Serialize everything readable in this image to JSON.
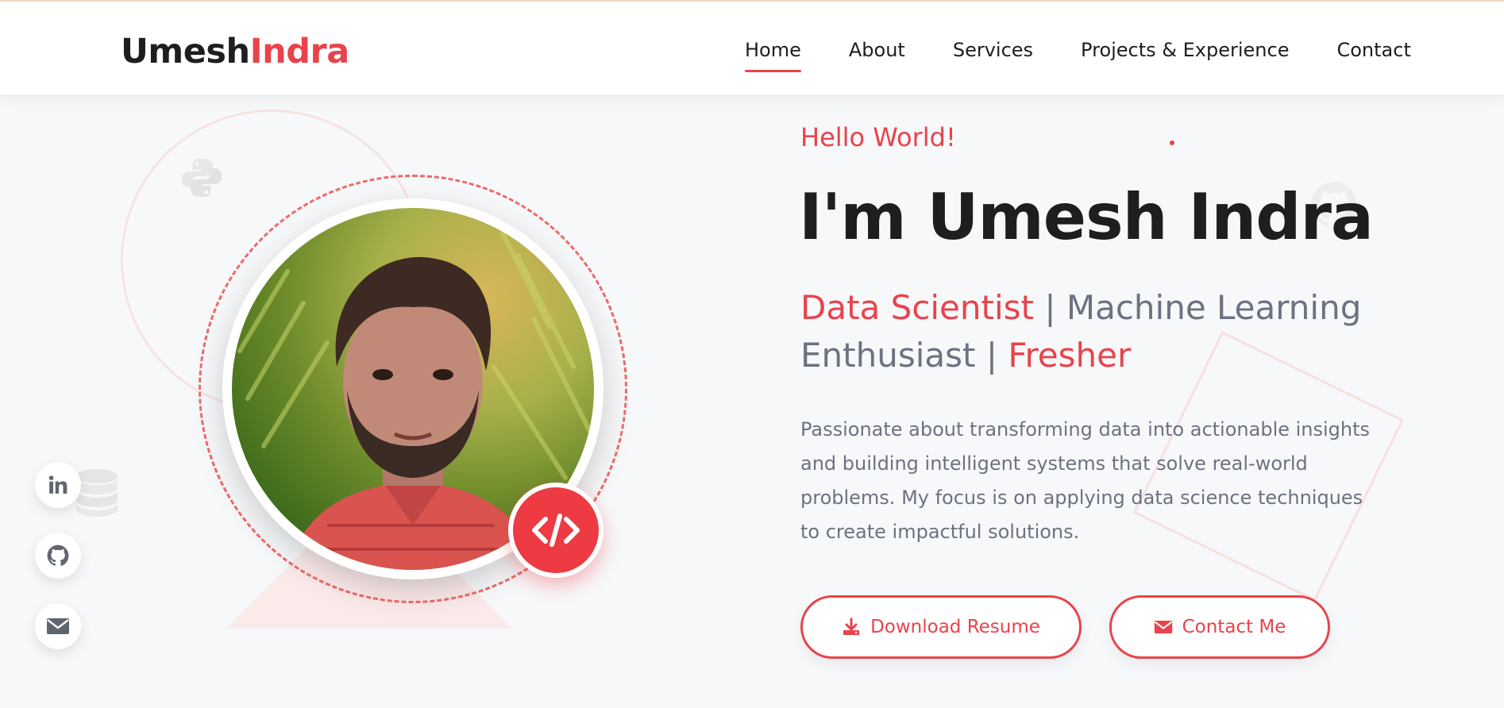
{
  "brand": {
    "first": "Umesh",
    "second": "Indra"
  },
  "nav": {
    "items": [
      "Home",
      "About",
      "Services",
      "Projects & Experience",
      "Contact"
    ],
    "active": "Home"
  },
  "hero": {
    "greeting": "Hello World!",
    "name": "I'm Umesh Indra",
    "role_1": "Data Scientist",
    "sep_1": " | ",
    "role_2": "Machine Learning Enthusiast",
    "sep_2": " | ",
    "role_3": "Fresher",
    "description": "Passionate about transforming data into actionable insights and building intelligent systems that solve real-world problems. My focus is on applying data science techniques to create impactful solutions."
  },
  "buttons": {
    "resume": {
      "label": "Download Resume",
      "icon": "download-icon"
    },
    "contact": {
      "label": "Contact Me",
      "icon": "envelope-icon"
    }
  },
  "social": [
    {
      "icon": "linkedin-icon"
    },
    {
      "icon": "github-icon"
    },
    {
      "icon": "envelope-icon"
    }
  ],
  "profile": {
    "photo_icon": "profile-photo",
    "badge_icon": "code-icon"
  },
  "colors": {
    "accent": "#e8434b",
    "text_dark": "#1e1e1e",
    "text_muted": "#6b7280",
    "background": "#f7f8fa"
  }
}
